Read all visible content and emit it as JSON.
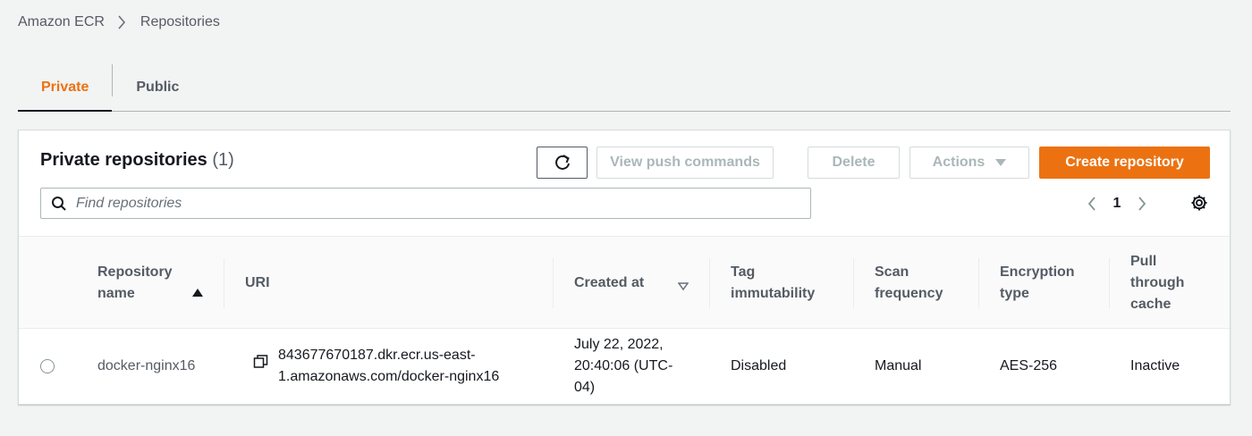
{
  "breadcrumb": {
    "root": "Amazon ECR",
    "current": "Repositories"
  },
  "tabs": [
    {
      "label": "Private",
      "active": true
    },
    {
      "label": "Public",
      "active": false
    }
  ],
  "panel": {
    "title": "Private repositories",
    "count": "(1)",
    "buttons": {
      "view_push": "View push commands",
      "delete": "Delete",
      "actions": "Actions",
      "create": "Create repository"
    },
    "search": {
      "placeholder": "Find repositories"
    },
    "pagination": {
      "page": "1"
    }
  },
  "table": {
    "columns": {
      "repo_name": [
        "Repository",
        "name"
      ],
      "uri": "URI",
      "created_at": "Created at",
      "tag_immutability": [
        "Tag",
        "immutability"
      ],
      "scan_frequency": [
        "Scan",
        "frequency"
      ],
      "encryption_type": [
        "Encryption",
        "type"
      ],
      "pull_through_cache": [
        "Pull",
        "through",
        "cache"
      ]
    },
    "rows": [
      {
        "repo_name": "docker-nginx16",
        "uri": [
          "843677670187.dkr.ecr.us-east-",
          "1.amazonaws.com/docker-nginx16"
        ],
        "created_at": [
          "July 22, 2022,",
          "20:40:06 (UTC-",
          "04)"
        ],
        "tag_immutability": "Disabled",
        "scan_frequency": "Manual",
        "encryption_type": "AES-256",
        "pull_through_cache": "Inactive"
      }
    ]
  },
  "colors": {
    "accent": "#ec7211",
    "text": "#16191f",
    "muted": "#545b64",
    "disabled": "#aab7b8"
  }
}
